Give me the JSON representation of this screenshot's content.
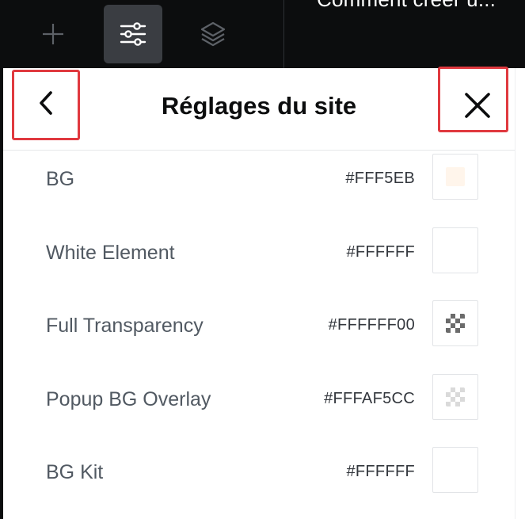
{
  "toolbar": {
    "tools": [
      {
        "name": "add",
        "icon": "plus-icon",
        "active": false
      },
      {
        "name": "site-settings",
        "icon": "sliders-icon",
        "active": true
      },
      {
        "name": "structure",
        "icon": "layers-icon",
        "active": false
      }
    ],
    "document_title": "Comment créer u..."
  },
  "panel": {
    "title": "Réglages du site",
    "back_icon": "chevron-left-icon",
    "close_icon": "close-icon"
  },
  "colors": [
    {
      "name": "BG",
      "hex": "#FFF5EB",
      "swatch": "#FFF5EB",
      "transparent": false
    },
    {
      "name": "White Element",
      "hex": "#FFFFFF",
      "swatch": "#FFFFFF",
      "transparent": false
    },
    {
      "name": "Full Transparency",
      "hex": "#FFFFFF00",
      "swatch": "#FFFFFF00",
      "transparent": true,
      "checker_color": "#6b6b6b"
    },
    {
      "name": "Popup BG Overlay",
      "hex": "#FFFAF5CC",
      "swatch": "#FFFAF5CC",
      "transparent": true,
      "checker_color": "#dadada"
    },
    {
      "name": "BG Kit",
      "hex": "#FFFFFF",
      "swatch": "#FFFFFF",
      "transparent": false
    }
  ],
  "theme": {
    "toolbar_bg": "#0C0D0E",
    "active_tool_bg": "#3A3D42",
    "highlight_border": "#E0393F"
  }
}
